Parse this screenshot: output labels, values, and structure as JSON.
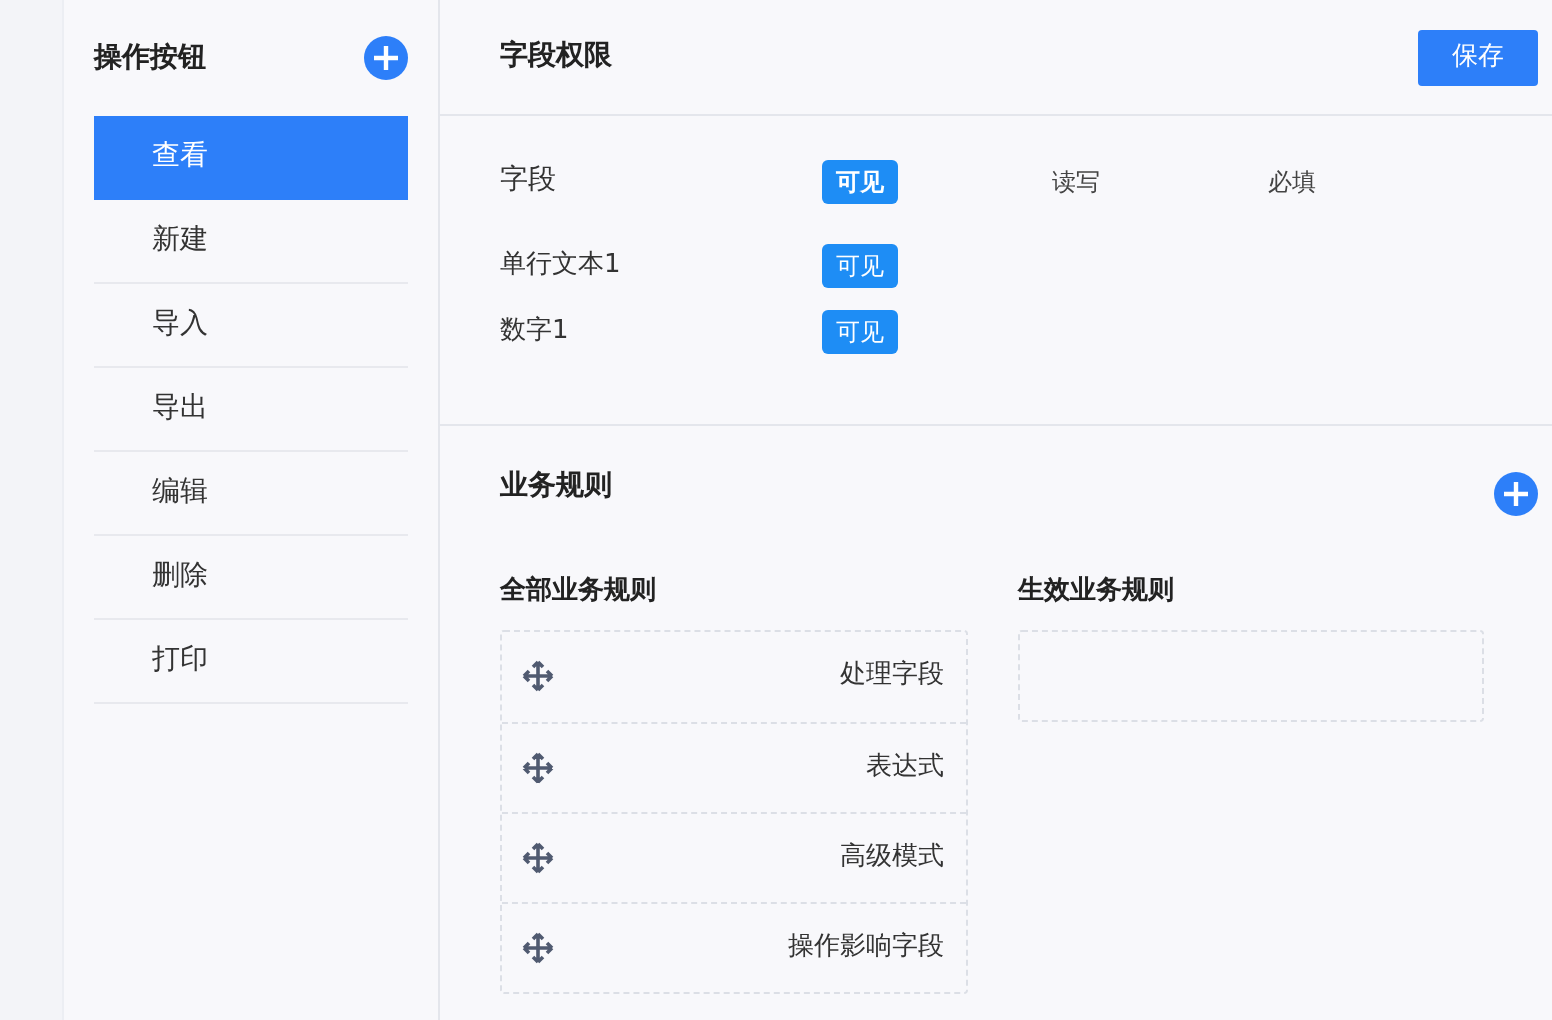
{
  "sidebar": {
    "title": "操作按钮",
    "items": [
      {
        "label": "查看",
        "selected": true
      },
      {
        "label": "新建",
        "selected": false
      },
      {
        "label": "导入",
        "selected": false
      },
      {
        "label": "导出",
        "selected": false
      },
      {
        "label": "编辑",
        "selected": false
      },
      {
        "label": "删除",
        "selected": false
      },
      {
        "label": "打印",
        "selected": false
      }
    ]
  },
  "field_permissions": {
    "title": "字段权限",
    "save_button": "保存",
    "header_label": "字段",
    "columns": [
      {
        "label": "可见",
        "selected": true
      },
      {
        "label": "读写",
        "selected": false
      },
      {
        "label": "必填",
        "selected": false
      }
    ],
    "rows": [
      {
        "name": "单行文本1",
        "tag": "可见"
      },
      {
        "name": "数字1",
        "tag": "可见"
      }
    ]
  },
  "business_rules": {
    "title": "业务规则",
    "all_rules_title": "全部业务规则",
    "rules": [
      "处理字段",
      "表达式",
      "高级模式",
      "操作影响字段"
    ],
    "active_rules_title": "生效业务规则"
  }
}
